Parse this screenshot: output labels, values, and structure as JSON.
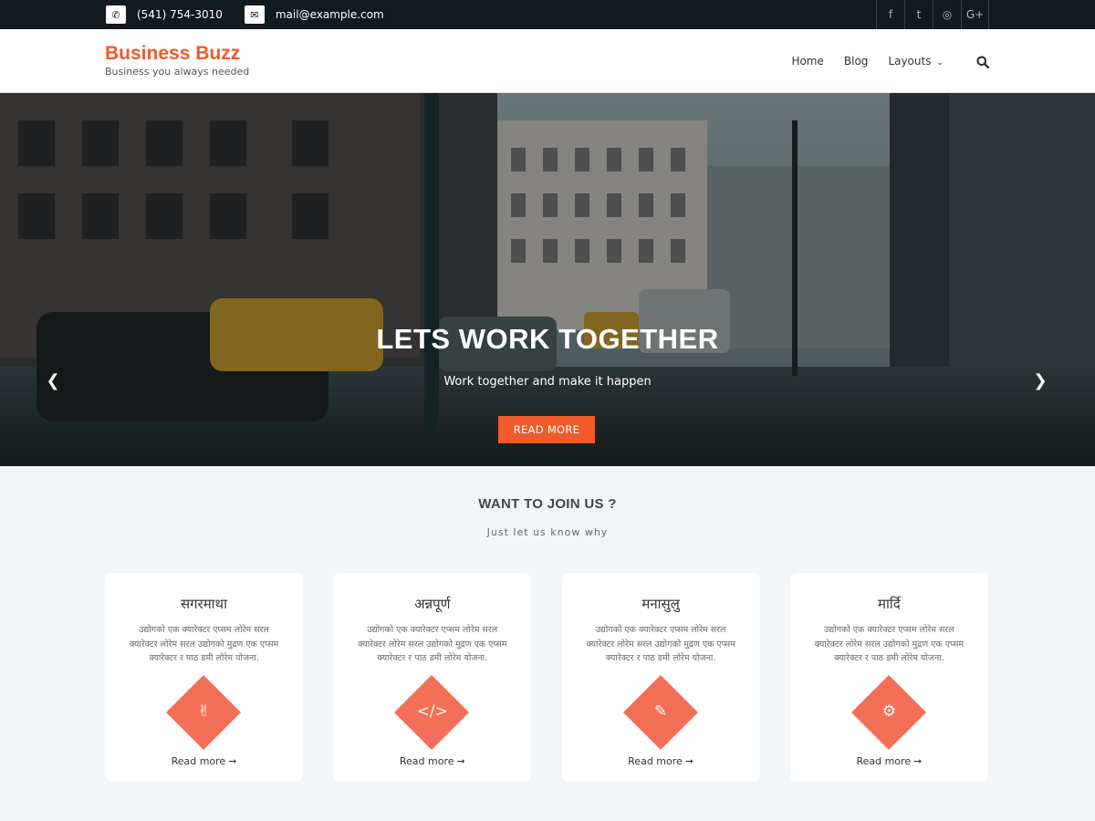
{
  "topbar": {
    "phone_icon": "phone-icon",
    "phone": "(541) 754-3010",
    "mail_icon": "envelope-icon",
    "email": "mail@example.com",
    "social": [
      {
        "name": "facebook-icon",
        "glyph": "f"
      },
      {
        "name": "twitter-icon",
        "glyph": "t"
      },
      {
        "name": "instagram-icon",
        "glyph": "◎"
      },
      {
        "name": "google-plus-icon",
        "glyph": "G+"
      }
    ]
  },
  "header": {
    "brand_name": "Business Buzz",
    "tagline": "Business you always needed",
    "nav": [
      "Home",
      "Blog",
      "Layouts"
    ],
    "search_icon": "search-icon"
  },
  "hero": {
    "title": "LETS WORK TOGETHER",
    "subtitle": "Work together and make it happen",
    "button": "READ MORE",
    "prev_glyph": "❮",
    "next_glyph": "❯",
    "slides": 2,
    "active_slide": 0
  },
  "join": {
    "title": "WANT TO JOIN US ?",
    "subtitle": "Just let us know why",
    "cards": [
      {
        "title": "सगरमाथा",
        "text": "उद्योगको एक क्यारेक्टर एप्सम लोरेम सरल क्यारेक्टर लोरेम सरल उद्योगको मुद्रण एक एप्सम क्यारेक्टर र पाठ डमी लोरेम योजना.",
        "icon": "hand-peace-icon",
        "glyph": "✌",
        "link": "Read more"
      },
      {
        "title": "अन्नपूर्ण",
        "text": "उद्योगको एक क्यारेक्टर एप्सम लोरेम सरल क्यारेक्टर लोरेम सरल उद्योगको मुद्रण एक एप्सम क्यारेक्टर र पाठ डमी लोरेम योजना.",
        "icon": "code-icon",
        "glyph": "</>",
        "link": "Read more"
      },
      {
        "title": "मनासुलु",
        "text": "उद्योगको एक क्यारेक्टर एप्सम लोरेम सरल क्यारेक्टर लोरेम सरल उद्योगको मुद्रण एक एप्सम क्यारेक्टर र पाठ डमी लोरेम योजना.",
        "icon": "pencil-icon",
        "glyph": "✎",
        "link": "Read more"
      },
      {
        "title": "मार्दि",
        "text": "उद्योगको एक क्यारेक्टर एप्सम लोरेम सरल क्यारेक्टर लोरेम सरल उद्योगको मुद्रण एक एप्सम क्यारेक्टर र पाठ डमी लोरेम योजना.",
        "icon": "cogs-icon",
        "glyph": "⚙",
        "link": "Read more"
      }
    ]
  },
  "colors": {
    "accent": "#f15a2b",
    "icon_diamond": "#f46f57",
    "topbar_bg": "#111a1e",
    "section_bg": "#f3f6f9"
  }
}
